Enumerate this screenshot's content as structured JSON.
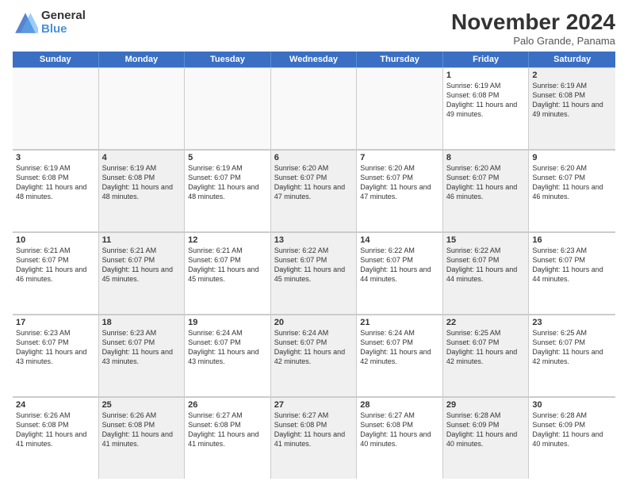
{
  "logo": {
    "general": "General",
    "blue": "Blue"
  },
  "title": "November 2024",
  "subtitle": "Palo Grande, Panama",
  "weekdays": [
    "Sunday",
    "Monday",
    "Tuesday",
    "Wednesday",
    "Thursday",
    "Friday",
    "Saturday"
  ],
  "rows": [
    [
      {
        "day": "",
        "info": "",
        "shaded": false,
        "empty": true
      },
      {
        "day": "",
        "info": "",
        "shaded": false,
        "empty": true
      },
      {
        "day": "",
        "info": "",
        "shaded": false,
        "empty": true
      },
      {
        "day": "",
        "info": "",
        "shaded": false,
        "empty": true
      },
      {
        "day": "",
        "info": "",
        "shaded": false,
        "empty": true
      },
      {
        "day": "1",
        "info": "Sunrise: 6:19 AM\nSunset: 6:08 PM\nDaylight: 11 hours and 49 minutes.",
        "shaded": false,
        "empty": false
      },
      {
        "day": "2",
        "info": "Sunrise: 6:19 AM\nSunset: 6:08 PM\nDaylight: 11 hours and 49 minutes.",
        "shaded": true,
        "empty": false
      }
    ],
    [
      {
        "day": "3",
        "info": "Sunrise: 6:19 AM\nSunset: 6:08 PM\nDaylight: 11 hours and 48 minutes.",
        "shaded": false,
        "empty": false
      },
      {
        "day": "4",
        "info": "Sunrise: 6:19 AM\nSunset: 6:08 PM\nDaylight: 11 hours and 48 minutes.",
        "shaded": true,
        "empty": false
      },
      {
        "day": "5",
        "info": "Sunrise: 6:19 AM\nSunset: 6:07 PM\nDaylight: 11 hours and 48 minutes.",
        "shaded": false,
        "empty": false
      },
      {
        "day": "6",
        "info": "Sunrise: 6:20 AM\nSunset: 6:07 PM\nDaylight: 11 hours and 47 minutes.",
        "shaded": true,
        "empty": false
      },
      {
        "day": "7",
        "info": "Sunrise: 6:20 AM\nSunset: 6:07 PM\nDaylight: 11 hours and 47 minutes.",
        "shaded": false,
        "empty": false
      },
      {
        "day": "8",
        "info": "Sunrise: 6:20 AM\nSunset: 6:07 PM\nDaylight: 11 hours and 46 minutes.",
        "shaded": true,
        "empty": false
      },
      {
        "day": "9",
        "info": "Sunrise: 6:20 AM\nSunset: 6:07 PM\nDaylight: 11 hours and 46 minutes.",
        "shaded": false,
        "empty": false
      }
    ],
    [
      {
        "day": "10",
        "info": "Sunrise: 6:21 AM\nSunset: 6:07 PM\nDaylight: 11 hours and 46 minutes.",
        "shaded": false,
        "empty": false
      },
      {
        "day": "11",
        "info": "Sunrise: 6:21 AM\nSunset: 6:07 PM\nDaylight: 11 hours and 45 minutes.",
        "shaded": true,
        "empty": false
      },
      {
        "day": "12",
        "info": "Sunrise: 6:21 AM\nSunset: 6:07 PM\nDaylight: 11 hours and 45 minutes.",
        "shaded": false,
        "empty": false
      },
      {
        "day": "13",
        "info": "Sunrise: 6:22 AM\nSunset: 6:07 PM\nDaylight: 11 hours and 45 minutes.",
        "shaded": true,
        "empty": false
      },
      {
        "day": "14",
        "info": "Sunrise: 6:22 AM\nSunset: 6:07 PM\nDaylight: 11 hours and 44 minutes.",
        "shaded": false,
        "empty": false
      },
      {
        "day": "15",
        "info": "Sunrise: 6:22 AM\nSunset: 6:07 PM\nDaylight: 11 hours and 44 minutes.",
        "shaded": true,
        "empty": false
      },
      {
        "day": "16",
        "info": "Sunrise: 6:23 AM\nSunset: 6:07 PM\nDaylight: 11 hours and 44 minutes.",
        "shaded": false,
        "empty": false
      }
    ],
    [
      {
        "day": "17",
        "info": "Sunrise: 6:23 AM\nSunset: 6:07 PM\nDaylight: 11 hours and 43 minutes.",
        "shaded": false,
        "empty": false
      },
      {
        "day": "18",
        "info": "Sunrise: 6:23 AM\nSunset: 6:07 PM\nDaylight: 11 hours and 43 minutes.",
        "shaded": true,
        "empty": false
      },
      {
        "day": "19",
        "info": "Sunrise: 6:24 AM\nSunset: 6:07 PM\nDaylight: 11 hours and 43 minutes.",
        "shaded": false,
        "empty": false
      },
      {
        "day": "20",
        "info": "Sunrise: 6:24 AM\nSunset: 6:07 PM\nDaylight: 11 hours and 42 minutes.",
        "shaded": true,
        "empty": false
      },
      {
        "day": "21",
        "info": "Sunrise: 6:24 AM\nSunset: 6:07 PM\nDaylight: 11 hours and 42 minutes.",
        "shaded": false,
        "empty": false
      },
      {
        "day": "22",
        "info": "Sunrise: 6:25 AM\nSunset: 6:07 PM\nDaylight: 11 hours and 42 minutes.",
        "shaded": true,
        "empty": false
      },
      {
        "day": "23",
        "info": "Sunrise: 6:25 AM\nSunset: 6:07 PM\nDaylight: 11 hours and 42 minutes.",
        "shaded": false,
        "empty": false
      }
    ],
    [
      {
        "day": "24",
        "info": "Sunrise: 6:26 AM\nSunset: 6:08 PM\nDaylight: 11 hours and 41 minutes.",
        "shaded": false,
        "empty": false
      },
      {
        "day": "25",
        "info": "Sunrise: 6:26 AM\nSunset: 6:08 PM\nDaylight: 11 hours and 41 minutes.",
        "shaded": true,
        "empty": false
      },
      {
        "day": "26",
        "info": "Sunrise: 6:27 AM\nSunset: 6:08 PM\nDaylight: 11 hours and 41 minutes.",
        "shaded": false,
        "empty": false
      },
      {
        "day": "27",
        "info": "Sunrise: 6:27 AM\nSunset: 6:08 PM\nDaylight: 11 hours and 41 minutes.",
        "shaded": true,
        "empty": false
      },
      {
        "day": "28",
        "info": "Sunrise: 6:27 AM\nSunset: 6:08 PM\nDaylight: 11 hours and 40 minutes.",
        "shaded": false,
        "empty": false
      },
      {
        "day": "29",
        "info": "Sunrise: 6:28 AM\nSunset: 6:09 PM\nDaylight: 11 hours and 40 minutes.",
        "shaded": true,
        "empty": false
      },
      {
        "day": "30",
        "info": "Sunrise: 6:28 AM\nSunset: 6:09 PM\nDaylight: 11 hours and 40 minutes.",
        "shaded": false,
        "empty": false
      }
    ]
  ]
}
